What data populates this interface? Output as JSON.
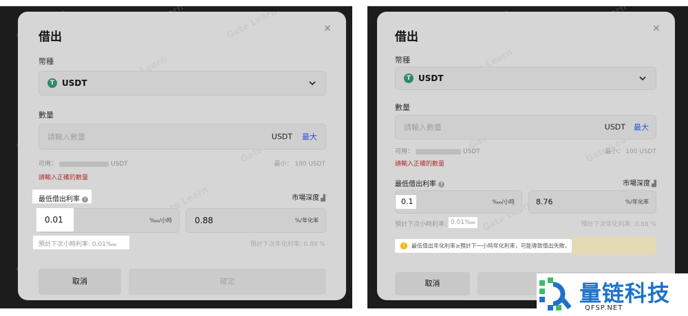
{
  "watermark": "Gate Learn",
  "left": {
    "title": "借出",
    "currency_label": "幣種",
    "coin": {
      "symbol_icon": "tether-icon",
      "glyph": "T",
      "name": "USDT"
    },
    "amount_label": "數量",
    "amount_placeholder": "請輸入數量",
    "amount_unit": "USDT",
    "max_label": "最大",
    "available_prefix": "可用：",
    "available_suffix": "USDT",
    "min_text": "最小： 100 USDT",
    "error_text": "請輸入正確的數量",
    "min_rate_label": "最低借出利率",
    "market_depth_label": "市場深度",
    "hourly_rate_value": "0.01",
    "hourly_rate_suffix": "‱/小時",
    "annual_rate_value": "0.88",
    "annual_rate_suffix": "%/年化率",
    "next_hour_hint": "預計下次小時利率: 0.01‱",
    "next_annual_hint": "預計下次年化利率: 0.88 %",
    "cancel_label": "取消",
    "confirm_label": "確定"
  },
  "right": {
    "title": "借出",
    "currency_label": "幣種",
    "coin": {
      "symbol_icon": "tether-icon",
      "glyph": "T",
      "name": "USDT"
    },
    "amount_label": "數量",
    "amount_placeholder": "請輸入數量",
    "amount_unit": "USDT",
    "max_label": "最大",
    "available_prefix": "可用：",
    "available_suffix": "USDT",
    "min_text": "最小： 100 USDT",
    "error_text": "請輸入正確的數量",
    "min_rate_label": "最低借出利率",
    "market_depth_label": "市場深度",
    "hourly_rate_value": "0.1",
    "hourly_rate_suffix": "‱/小時",
    "annual_rate_value": "8.76",
    "annual_rate_suffix": "%/年化率",
    "next_hour_prefix": "預計下次小時利率:",
    "next_hour_value": "0.01‱",
    "next_annual_hint": "預計下次年化利率: 0.88 %",
    "warning_text": "最低借出年化利率≥預計下一小時年化利率，可能導致借出失敗，",
    "cancel_label": "取消"
  },
  "brand": {
    "name": "量链科技",
    "domain": "QFSP.NET",
    "color": "#1e73c8",
    "accent": "#3dbb6b"
  },
  "colors": {
    "max_link": "#2a4fd6",
    "error": "#b03030",
    "warning_icon": "#f2b400"
  }
}
